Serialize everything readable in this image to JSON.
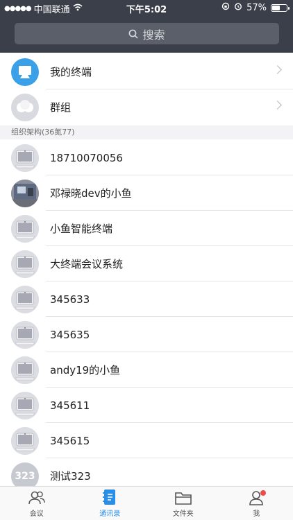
{
  "status_bar": {
    "carrier": "中国联通",
    "time": "下午5:02",
    "battery": "57%",
    "battery_level": 0.57
  },
  "search": {
    "placeholder": "搜索"
  },
  "top_items": [
    {
      "label": "我的终端",
      "icon": "terminal-icon"
    },
    {
      "label": "群组",
      "icon": "group-icon"
    }
  ],
  "section_header": "组织架构(36氮77)",
  "contacts": [
    {
      "name": "18710070056",
      "avatar": "device"
    },
    {
      "name": "邓禄晓dev的小鱼",
      "avatar": "photo"
    },
    {
      "name": "小鱼智能终端",
      "avatar": "device"
    },
    {
      "name": "大终端会议系统",
      "avatar": "device"
    },
    {
      "name": "345633",
      "avatar": "device"
    },
    {
      "name": "345635",
      "avatar": "device"
    },
    {
      "name": "andy19的小鱼",
      "avatar": "device"
    },
    {
      "name": "345611",
      "avatar": "device"
    },
    {
      "name": "345615",
      "avatar": "device"
    },
    {
      "name": "测试323",
      "avatar": "text",
      "avatar_text": "323"
    }
  ],
  "tabbar": [
    {
      "label": "会议",
      "icon": "people-icon",
      "active": false
    },
    {
      "label": "通讯录",
      "icon": "address-book-icon",
      "active": true
    },
    {
      "label": "文件夹",
      "icon": "folder-icon",
      "active": false
    },
    {
      "label": "我",
      "icon": "person-icon",
      "active": false,
      "badge": true
    }
  ],
  "colors": {
    "header": "#3b3f4a",
    "accent": "#2a8ee6",
    "badge": "#ee4b4b"
  }
}
